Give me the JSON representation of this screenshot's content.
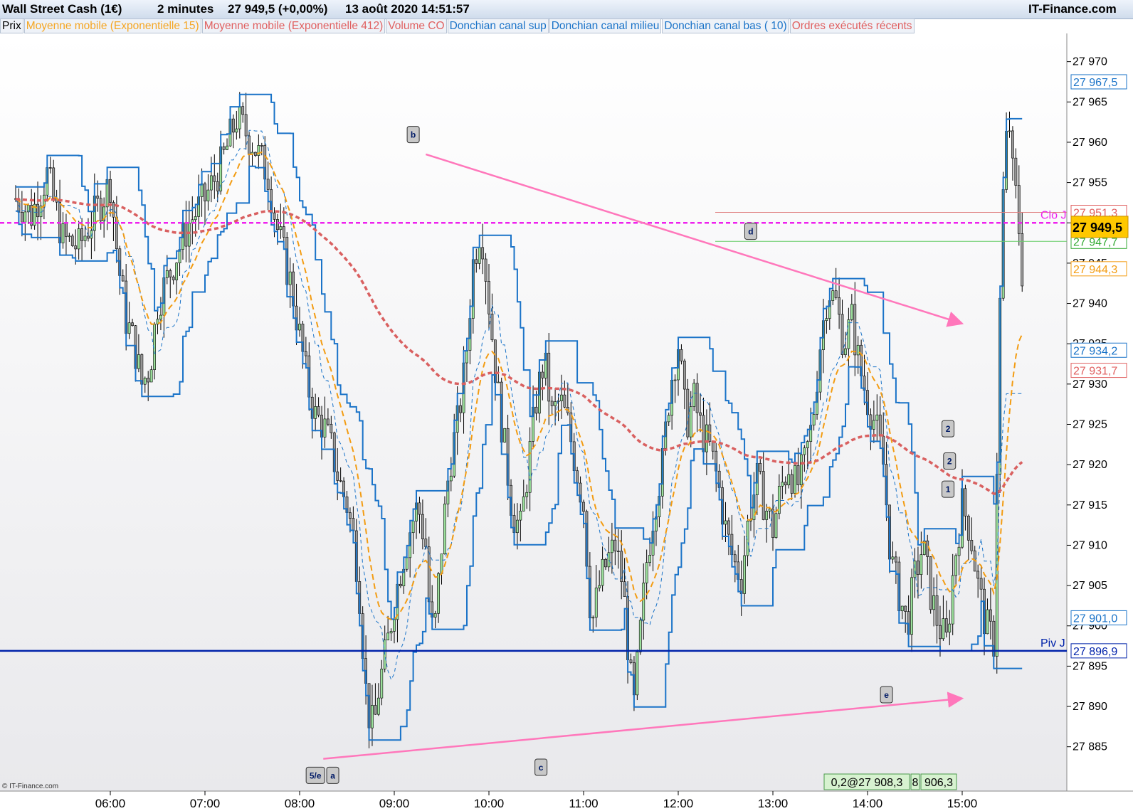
{
  "header": {
    "instrument": "Wall Street Cash (1€)",
    "timeframe": "2 minutes",
    "price_change": "27 949,5 (+0,00%)",
    "datetime": "13 août 2020 14:51:57",
    "brand": "IT-Finance.com"
  },
  "legend": [
    {
      "label": "Prix",
      "color": "#000000"
    },
    {
      "label": "Moyenne mobile (Exponentielle 15)",
      "color": "#f5a623"
    },
    {
      "label": "Moyenne mobile (Exponentielle 412)",
      "color": "#e06060"
    },
    {
      "label": "Volume CO",
      "color": "#e06060"
    },
    {
      "label": "Donchian canal sup",
      "color": "#1a73c8"
    },
    {
      "label": "Donchian canal milieu",
      "color": "#1a73c8"
    },
    {
      "label": "Donchian canal bas ( 10)",
      "color": "#1a73c8"
    },
    {
      "label": "Ordres exécutés récents",
      "color": "#e06060"
    }
  ],
  "copyright": "© IT-Finance.com",
  "chart_data": {
    "type": "candlestick",
    "xaxis": {
      "ticks": [
        "06:00",
        "07:00",
        "08:00",
        "09:00",
        "10:00",
        "11:00",
        "12:00",
        "13:00",
        "14:00",
        "15:00"
      ],
      "range": [
        "05:00",
        "15:40"
      ]
    },
    "yaxis": {
      "ticks": [
        27885,
        27890,
        27895,
        27900,
        27905,
        27910,
        27915,
        27920,
        27925,
        27930,
        27935,
        27940,
        27945,
        27950,
        27955,
        27960,
        27965,
        27970
      ],
      "range": [
        27879.5,
        27973.5
      ],
      "format": "fr"
    },
    "close_series": [
      [
        "05:00",
        27953
      ],
      [
        "05:10",
        27951
      ],
      [
        "05:20",
        27956
      ],
      [
        "05:30",
        27948
      ],
      [
        "05:40",
        27947
      ],
      [
        "05:50",
        27951
      ],
      [
        "06:00",
        27955
      ],
      [
        "06:05",
        27945
      ],
      [
        "06:10",
        27938
      ],
      [
        "06:15",
        27935
      ],
      [
        "06:20",
        27930
      ],
      [
        "06:25",
        27932
      ],
      [
        "06:30",
        27940
      ],
      [
        "06:40",
        27945
      ],
      [
        "06:50",
        27950
      ],
      [
        "07:00",
        27953
      ],
      [
        "07:10",
        27957
      ],
      [
        "07:20",
        27963
      ],
      [
        "07:30",
        27960
      ],
      [
        "07:40",
        27956
      ],
      [
        "07:45",
        27950
      ],
      [
        "07:50",
        27946
      ],
      [
        "07:55",
        27942
      ],
      [
        "08:00",
        27936
      ],
      [
        "08:05",
        27930
      ],
      [
        "08:10",
        27926
      ],
      [
        "08:15",
        27925
      ],
      [
        "08:20",
        27922
      ],
      [
        "08:25",
        27918
      ],
      [
        "08:30",
        27915
      ],
      [
        "08:35",
        27910
      ],
      [
        "08:38",
        27904
      ],
      [
        "08:40",
        27898
      ],
      [
        "08:42",
        27892
      ],
      [
        "08:44",
        27889
      ],
      [
        "08:47",
        27887
      ],
      [
        "08:50",
        27892
      ],
      [
        "08:55",
        27897
      ],
      [
        "09:00",
        27903
      ],
      [
        "09:05",
        27908
      ],
      [
        "09:10",
        27912
      ],
      [
        "09:15",
        27915
      ],
      [
        "09:20",
        27910
      ],
      [
        "09:22",
        27903
      ],
      [
        "09:25",
        27898
      ],
      [
        "09:30",
        27910
      ],
      [
        "09:35",
        27920
      ],
      [
        "09:40",
        27925
      ],
      [
        "09:45",
        27932
      ],
      [
        "09:50",
        27945
      ],
      [
        "09:55",
        27950
      ],
      [
        "10:00",
        27940
      ],
      [
        "10:05",
        27930
      ],
      [
        "10:10",
        27922
      ],
      [
        "10:15",
        27914
      ],
      [
        "10:20",
        27912
      ],
      [
        "10:25",
        27920
      ],
      [
        "10:30",
        27928
      ],
      [
        "10:35",
        27933
      ],
      [
        "10:40",
        27926
      ],
      [
        "10:45",
        27928
      ],
      [
        "10:50",
        27925
      ],
      [
        "10:55",
        27920
      ],
      [
        "11:00",
        27915
      ],
      [
        "11:05",
        27900
      ],
      [
        "11:10",
        27905
      ],
      [
        "11:15",
        27908
      ],
      [
        "11:20",
        27910
      ],
      [
        "11:25",
        27905
      ],
      [
        "11:30",
        27893
      ],
      [
        "11:32",
        27890
      ],
      [
        "11:35",
        27897
      ],
      [
        "11:40",
        27908
      ],
      [
        "11:45",
        27915
      ],
      [
        "11:50",
        27920
      ],
      [
        "11:55",
        27930
      ],
      [
        "12:00",
        27935
      ],
      [
        "12:05",
        27925
      ],
      [
        "12:10",
        27928
      ],
      [
        "12:15",
        27924
      ],
      [
        "12:20",
        27922
      ],
      [
        "12:25",
        27918
      ],
      [
        "12:30",
        27912
      ],
      [
        "12:35",
        27908
      ],
      [
        "12:40",
        27906
      ],
      [
        "12:45",
        27914
      ],
      [
        "12:50",
        27918
      ],
      [
        "12:55",
        27915
      ],
      [
        "13:00",
        27912
      ],
      [
        "13:05",
        27917
      ],
      [
        "13:10",
        27920
      ],
      [
        "13:15",
        27917
      ],
      [
        "13:20",
        27920
      ],
      [
        "13:25",
        27925
      ],
      [
        "13:30",
        27935
      ],
      [
        "13:35",
        27942
      ],
      [
        "13:40",
        27940
      ],
      [
        "13:45",
        27935
      ],
      [
        "13:50",
        27938
      ],
      [
        "13:55",
        27932
      ],
      [
        "14:00",
        27928
      ],
      [
        "14:05",
        27925
      ],
      [
        "14:10",
        27920
      ],
      [
        "14:15",
        27908
      ],
      [
        "14:20",
        27904
      ],
      [
        "14:25",
        27900
      ],
      [
        "14:30",
        27906
      ],
      [
        "14:35",
        27910
      ],
      [
        "14:40",
        27904
      ],
      [
        "14:45",
        27900
      ],
      [
        "14:50",
        27898
      ],
      [
        "14:55",
        27908
      ],
      [
        "15:00",
        27915
      ],
      [
        "15:05",
        27912
      ],
      [
        "15:10",
        27905
      ],
      [
        "15:15",
        27900
      ],
      [
        "15:20",
        27898
      ],
      [
        "15:22",
        27920
      ],
      [
        "15:25",
        27950
      ],
      [
        "15:28",
        27960
      ],
      [
        "15:30",
        27962
      ],
      [
        "15:32",
        27956
      ],
      [
        "15:35",
        27952
      ],
      [
        "15:38",
        27944
      ]
    ],
    "horizontal_levels": [
      {
        "name": "Clo J",
        "value": 27950.0,
        "color": "#ee22ee",
        "style": "dashed"
      },
      {
        "name": "Piv J",
        "value": 27896.9,
        "color": "#0022aa",
        "style": "solid"
      }
    ],
    "order_lines": [
      {
        "value": 27951.3,
        "color": "#e08080"
      },
      {
        "value": 27947.7,
        "color": "#66cc66"
      }
    ],
    "price_labels": [
      {
        "text": "27 967,5",
        "value": 27967.5,
        "color": "#1a73c8"
      },
      {
        "text": "27 951,3",
        "value": 27951.3,
        "color": "#e06060"
      },
      {
        "text": "27 947,7",
        "value": 27947.7,
        "color": "#33aa33"
      },
      {
        "text": "27 944,3",
        "value": 27944.3,
        "color": "#f39c12"
      },
      {
        "text": "27 934,2",
        "value": 27934.2,
        "color": "#1a73c8"
      },
      {
        "text": "27 931,7",
        "value": 27931.7,
        "color": "#e06060"
      },
      {
        "text": "27 901,0",
        "value": 27901.0,
        "color": "#1a73c8"
      },
      {
        "text": "27 896,9",
        "value": 27896.9,
        "color": "#0022aa"
      }
    ],
    "current_price": {
      "main": "27 949,5",
      "value": 27949.5
    },
    "trendlines": [
      {
        "from": [
          "09:20",
          27958.5
        ],
        "to": [
          "15:00",
          27937.5
        ],
        "color": "#ff77bb"
      },
      {
        "from": [
          "08:15",
          27883.5
        ],
        "to": [
          "15:00",
          27891.0
        ],
        "color": "#ff77bb"
      }
    ],
    "wave_labels": [
      {
        "text": "5/e",
        "at": [
          "08:10",
          27881.5
        ]
      },
      {
        "text": "a",
        "at": [
          "08:21",
          27881.5
        ]
      },
      {
        "text": "b",
        "at": [
          "09:12",
          27961.0
        ]
      },
      {
        "text": "c",
        "at": [
          "10:33",
          27882.5
        ]
      },
      {
        "text": "d",
        "at": [
          "12:46",
          27949.0
        ]
      },
      {
        "text": "e",
        "at": [
          "14:12",
          27891.5
        ]
      },
      {
        "text": "2",
        "at": [
          "14:51",
          27924.5
        ]
      },
      {
        "text": "2",
        "at": [
          "14:52",
          27920.5
        ]
      },
      {
        "text": "1",
        "at": [
          "14:51",
          27917.0
        ]
      }
    ],
    "order_info": [
      "0,2@27 908,3",
      "8",
      "906,3"
    ],
    "grid": false
  }
}
